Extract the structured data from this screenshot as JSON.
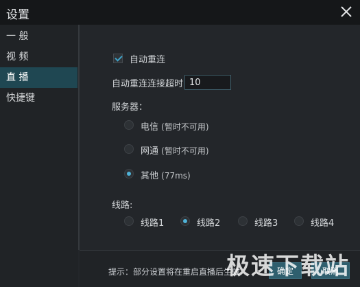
{
  "window": {
    "title": "设置"
  },
  "sidebar": {
    "items": [
      {
        "label": "一 般"
      },
      {
        "label": "视 频"
      },
      {
        "label": "直 播"
      },
      {
        "label": "快捷键"
      }
    ],
    "active_index": 2
  },
  "live": {
    "auto_reconnect": {
      "label": "自动重连",
      "checked": true
    },
    "timeout": {
      "label": "自动重连连接超时",
      "value": "10"
    },
    "server": {
      "label": "服务器：",
      "options": [
        {
          "name": "电信",
          "note": "(暂时不可用)",
          "selected": false
        },
        {
          "name": "网通",
          "note": "(暂时不可用)",
          "selected": false
        },
        {
          "name": "其他",
          "note": "(77ms)",
          "selected": true
        }
      ]
    },
    "line": {
      "label": "线路:",
      "options": [
        {
          "name": "线路1",
          "selected": false
        },
        {
          "name": "线路2",
          "selected": true
        },
        {
          "name": "线路3",
          "selected": false
        },
        {
          "name": "线路4",
          "selected": false
        }
      ]
    }
  },
  "footer": {
    "tip": "提示：部分设置将在重启直播后生效",
    "confirm": "确定",
    "cancel": "取消"
  },
  "watermark": "极速下载站",
  "colors": {
    "accent": "#4fb2d8",
    "active_bg": "#1f4752",
    "button": "#2f5f6e"
  }
}
